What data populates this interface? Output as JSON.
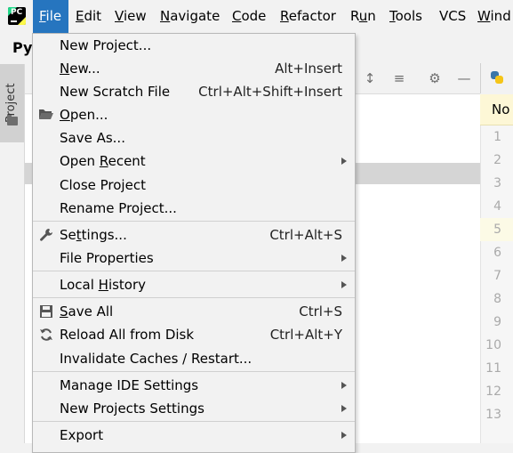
{
  "menubar": {
    "items": [
      {
        "label": "File",
        "mnemonic": "F",
        "rest": "ile"
      },
      {
        "label": "Edit",
        "mnemonic": "E",
        "rest": "dit"
      },
      {
        "label": "View",
        "mnemonic": "V",
        "rest": "iew"
      },
      {
        "label": "Navigate",
        "mnemonic": "N",
        "rest": "avigate"
      },
      {
        "label": "Code",
        "mnemonic": "C",
        "rest": "ode"
      },
      {
        "label": "Refactor",
        "mnemonic": "R",
        "rest": "efactor"
      },
      {
        "label": "Run",
        "pre": "R",
        "mnemonic": "u",
        "rest": "n"
      },
      {
        "label": "Tools",
        "mnemonic": "T",
        "rest": "ools"
      },
      {
        "label": "VCS",
        "mnemonic": "",
        "rest": "VCS"
      },
      {
        "label": "Wind",
        "mnemonic": "W",
        "rest": "ind"
      }
    ]
  },
  "app_logo_text": "PC",
  "project_title": "Py",
  "left_strip": {
    "project_tab_label": "Project"
  },
  "editor": {
    "banner_text": "No",
    "line_numbers": [
      "1",
      "2",
      "3",
      "4",
      "5",
      "6",
      "7",
      "8",
      "9",
      "10",
      "11",
      "12",
      "13"
    ],
    "current_line": "5"
  },
  "file_menu": {
    "items": [
      {
        "pre": "",
        "mn": "",
        "post": "New Project...",
        "shortcut": "",
        "submenu": false
      },
      {
        "pre": "",
        "mn": "N",
        "post": "ew...",
        "shortcut": "Alt+Insert",
        "submenu": false
      },
      {
        "pre": "",
        "mn": "",
        "post": "New Scratch File",
        "shortcut": "Ctrl+Alt+Shift+Insert",
        "submenu": false
      },
      {
        "pre": "",
        "mn": "O",
        "post": "pen...",
        "shortcut": "",
        "submenu": false,
        "icon": "folder-open-icon"
      },
      {
        "pre": "",
        "mn": "",
        "post": "Save As...",
        "shortcut": "",
        "submenu": false
      },
      {
        "pre": "Open ",
        "mn": "R",
        "post": "ecent",
        "shortcut": "",
        "submenu": true
      },
      {
        "pre": "",
        "mn": "",
        "post": "Close Project",
        "shortcut": "",
        "submenu": false
      },
      {
        "pre": "",
        "mn": "",
        "post": "Rename Project...",
        "shortcut": "",
        "submenu": false
      },
      {
        "pre": "Se",
        "mn": "t",
        "post": "tings...",
        "shortcut": "Ctrl+Alt+S",
        "submenu": false,
        "icon": "wrench-icon"
      },
      {
        "pre": "",
        "mn": "",
        "post": "File Properties",
        "shortcut": "",
        "submenu": true
      },
      {
        "pre": "Local ",
        "mn": "H",
        "post": "istory",
        "shortcut": "",
        "submenu": true
      },
      {
        "pre": "",
        "mn": "S",
        "post": "ave All",
        "shortcut": "Ctrl+S",
        "submenu": false,
        "icon": "save-icon"
      },
      {
        "pre": "",
        "mn": "",
        "post": "Reload All from Disk",
        "shortcut": "Ctrl+Alt+Y",
        "submenu": false,
        "icon": "reload-icon"
      },
      {
        "pre": "",
        "mn": "",
        "post": "Invalidate Caches / Restart...",
        "shortcut": "",
        "submenu": false
      },
      {
        "pre": "",
        "mn": "",
        "post": "Manage IDE Settings",
        "shortcut": "",
        "submenu": true
      },
      {
        "pre": "",
        "mn": "",
        "post": "New Projects Settings",
        "shortcut": "",
        "submenu": true
      },
      {
        "pre": "",
        "mn": "",
        "post": "Export",
        "shortcut": "",
        "submenu": true
      }
    ]
  },
  "colors": {
    "menu_active": "#2675bf",
    "background": "#f2f2f2",
    "selection": "#d5d5d5",
    "banner": "#fdf7d6"
  }
}
